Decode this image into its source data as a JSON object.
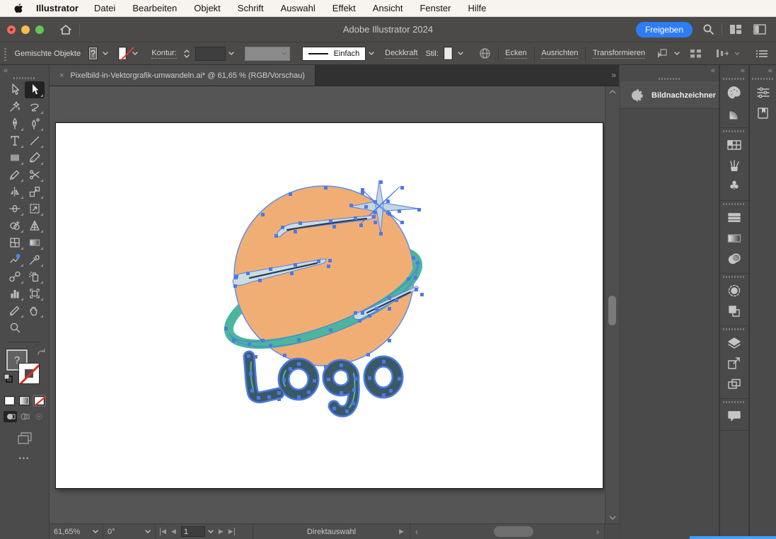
{
  "menubar": {
    "app": "Illustrator",
    "items": [
      "Datei",
      "Bearbeiten",
      "Objekt",
      "Schrift",
      "Auswahl",
      "Effekt",
      "Ansicht",
      "Fenster",
      "Hilfe"
    ]
  },
  "titlebar": {
    "title": "Adobe Illustrator 2024",
    "share_label": "Freigeben"
  },
  "controlbar": {
    "selection_label": "Gemischte Objekte",
    "fill_unknown": "?",
    "kontur_label": "Kontur:",
    "stroke_style_value": "Einfach",
    "deckkraft_label": "Deckkraft",
    "stil_label": "Stil:",
    "ecken_label": "Ecken",
    "ausrichten_label": "Ausrichten",
    "transformieren_label": "Transformieren"
  },
  "document_tab": {
    "title": "Pixelbild-in-Vektorgrafik-umwandeln.ai* @ 61,65 % (RGB/Vorschau)"
  },
  "toolbar": {
    "fill_unknown": "?",
    "ellipsis": "•••"
  },
  "right_panels": {
    "image_trace_label": "Bildnachzeichner",
    "symbols_glyph": "♣"
  },
  "statusbar": {
    "zoom": "61,65%",
    "rotation": "0°",
    "artboard_number": "1",
    "tool_label": "Direktauswahl"
  },
  "icons": {
    "collapse_left": "«",
    "overflow_right": "»",
    "close": "×",
    "nav_first": "◀",
    "nav_prev": "◀",
    "nav_next": "▶",
    "nav_last": "▶",
    "status_play": "▶",
    "scroll_left": "‹",
    "scroll_right": "›"
  },
  "artwork": {
    "logo_text": "Logo",
    "planet_color": "#f1ae74",
    "ring_color": "#4bb59d",
    "star_color": "#c3d6df",
    "swoosh_color": "#cbdce3",
    "logo_color": "#3a5966",
    "anchor_color": "#4d79e8"
  },
  "colors": {
    "accent_blue": "#2e7df7",
    "ui_dark": "#4c4a48",
    "pasteboard": "#555555"
  }
}
